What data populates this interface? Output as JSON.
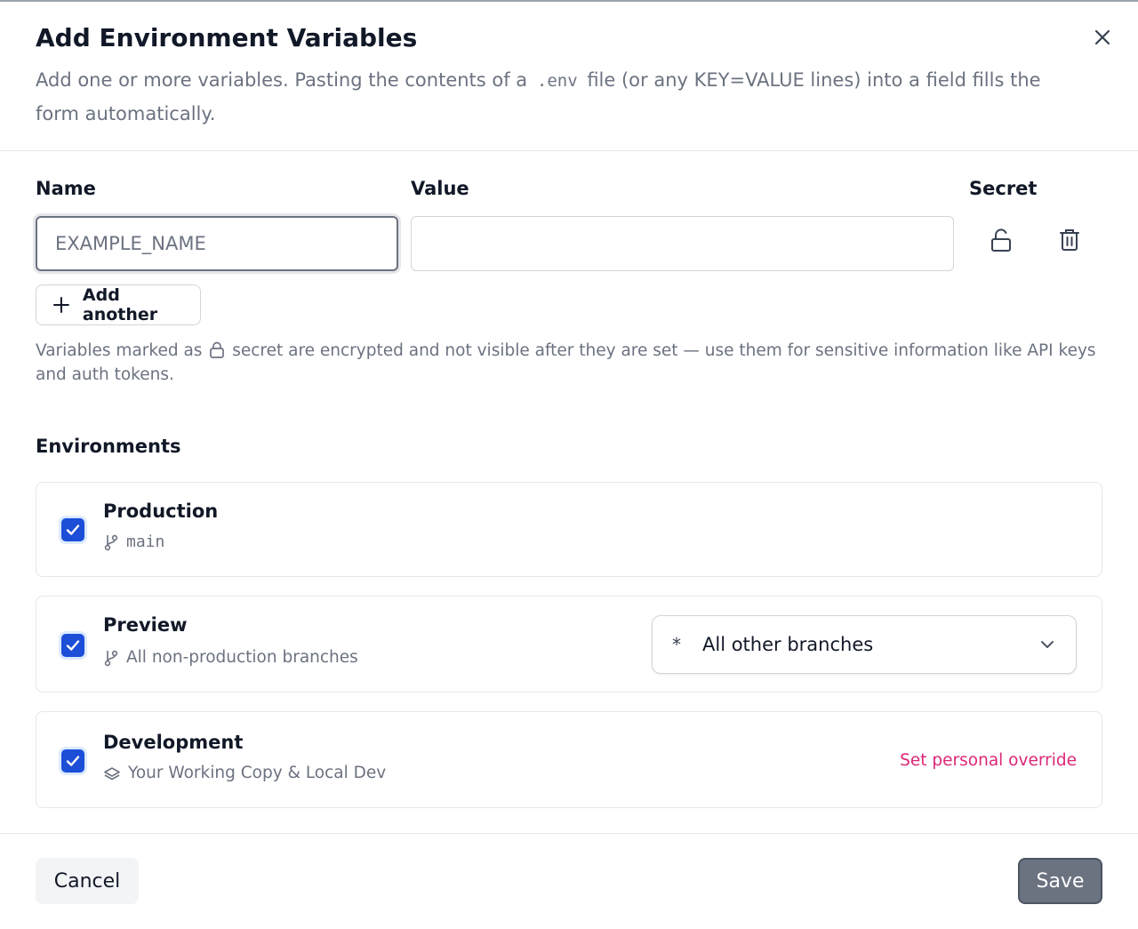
{
  "dialog": {
    "title": "Add Environment Variables",
    "subtitle_before": "Add one or more variables. Pasting the contents of a",
    "subtitle_code": ".env",
    "subtitle_after": "file (or any KEY=VALUE lines) into a field fills the form automatically.",
    "close_icon": "close-icon"
  },
  "form": {
    "name_label": "Name",
    "value_label": "Value",
    "secret_label": "Secret",
    "name_placeholder": "EXAMPLE_NAME",
    "name_value": "",
    "value_value": "",
    "secret_icon": "unlock-icon",
    "delete_icon": "trash-icon",
    "add_another_label": "Add another",
    "note_before": "Variables marked as",
    "note_after": "secret are encrypted and not visible after they are set — use them for sensitive information like API keys and auth tokens."
  },
  "environments": {
    "heading": "Environments",
    "items": [
      {
        "title": "Production",
        "subtitle": "main",
        "checked": true,
        "icon": "branch-icon"
      },
      {
        "title": "Preview",
        "subtitle": "All non-production branches",
        "checked": true,
        "icon": "branch-icon",
        "branch_select": {
          "icon": "*",
          "value": "All other branches"
        }
      },
      {
        "title": "Development",
        "subtitle": "Your Working Copy & Local Dev",
        "checked": true,
        "icon": "layers-icon",
        "action": "Set personal override"
      }
    ]
  },
  "footer": {
    "cancel_label": "Cancel",
    "save_label": "Save"
  },
  "colors": {
    "checkbox": "#1d4ed8",
    "link_accent": "#db2777",
    "save_bg": "#6b7280"
  }
}
